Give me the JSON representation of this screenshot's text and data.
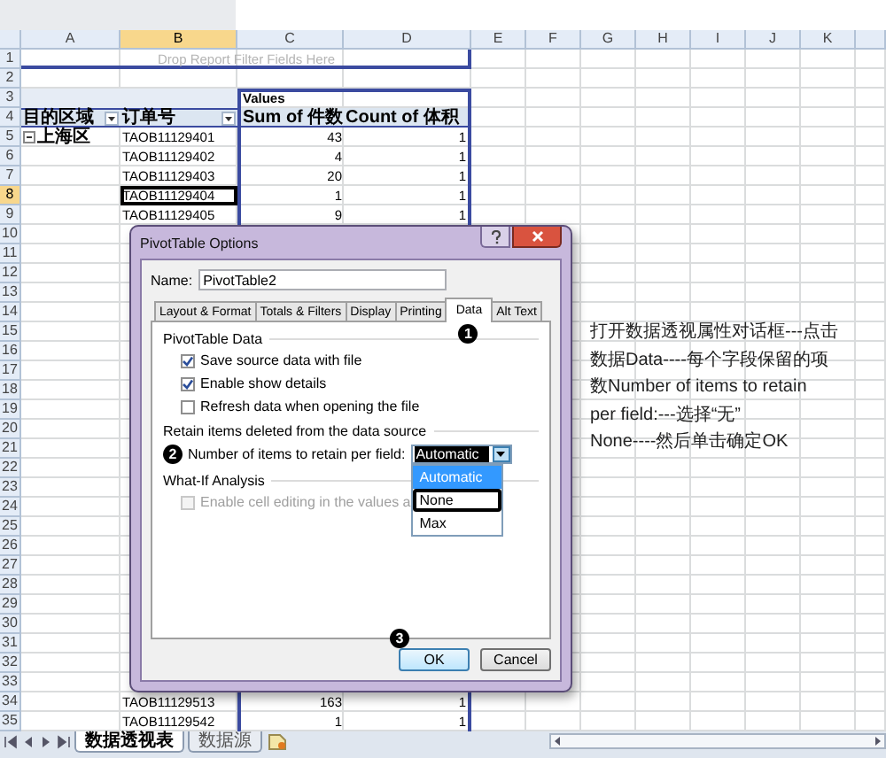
{
  "sheet": {
    "columns": [
      {
        "label": "A",
        "selected": false
      },
      {
        "label": "B",
        "selected": true
      },
      {
        "label": "C",
        "selected": false
      },
      {
        "label": "D",
        "selected": false
      },
      {
        "label": "E",
        "selected": false
      },
      {
        "label": "F",
        "selected": false
      },
      {
        "label": "G",
        "selected": false
      },
      {
        "label": "H",
        "selected": false
      },
      {
        "label": "I",
        "selected": false
      },
      {
        "label": "J",
        "selected": false
      },
      {
        "label": "K",
        "selected": false
      }
    ],
    "rows": [
      {
        "number": "1",
        "selected": false,
        "kind": "filter_area",
        "cells": {
          "col_a": "Drop Report Filter Fields Here"
        }
      },
      {
        "number": "2",
        "selected": false,
        "kind": "blank"
      },
      {
        "number": "3",
        "selected": false,
        "kind": "values_label",
        "cells": {
          "col_c": "Values"
        }
      },
      {
        "number": "4",
        "selected": false,
        "kind": "field_header",
        "cells": {
          "col_a": "目的区域",
          "col_b": "订单号",
          "col_c": "Sum of 件数",
          "col_d": "Count of 体积"
        }
      },
      {
        "number": "5",
        "selected": false,
        "kind": "group",
        "cells": {
          "col_a": "上海区",
          "col_b": "TAOB11129401",
          "col_c": "43",
          "col_d": "1"
        }
      },
      {
        "number": "6",
        "selected": false,
        "kind": "data",
        "cells": {
          "col_b": "TAOB11129402",
          "col_c": "4",
          "col_d": "1"
        }
      },
      {
        "number": "7",
        "selected": false,
        "kind": "data",
        "cells": {
          "col_b": "TAOB11129403",
          "col_c": "20",
          "col_d": "1"
        }
      },
      {
        "number": "8",
        "selected": true,
        "kind": "data",
        "cells": {
          "col_b": "TAOB11129404",
          "col_c": "1",
          "col_d": "1"
        }
      },
      {
        "number": "9",
        "selected": false,
        "kind": "data",
        "cells": {
          "col_b": "TAOB11129405",
          "col_c": "9",
          "col_d": "1"
        }
      },
      {
        "number": "10",
        "selected": false,
        "kind": "data"
      },
      {
        "number": "11",
        "selected": false,
        "kind": "data"
      },
      {
        "number": "12",
        "selected": false,
        "kind": "data"
      },
      {
        "number": "13",
        "selected": false,
        "kind": "data"
      },
      {
        "number": "14",
        "selected": false,
        "kind": "data"
      },
      {
        "number": "15",
        "selected": false,
        "kind": "data"
      },
      {
        "number": "16",
        "selected": false,
        "kind": "data"
      },
      {
        "number": "17",
        "selected": false,
        "kind": "data"
      },
      {
        "number": "18",
        "selected": false,
        "kind": "data"
      },
      {
        "number": "19",
        "selected": false,
        "kind": "data"
      },
      {
        "number": "20",
        "selected": false,
        "kind": "data"
      },
      {
        "number": "21",
        "selected": false,
        "kind": "data"
      },
      {
        "number": "22",
        "selected": false,
        "kind": "data"
      },
      {
        "number": "23",
        "selected": false,
        "kind": "data"
      },
      {
        "number": "24",
        "selected": false,
        "kind": "data"
      },
      {
        "number": "25",
        "selected": false,
        "kind": "data"
      },
      {
        "number": "26",
        "selected": false,
        "kind": "data"
      },
      {
        "number": "27",
        "selected": false,
        "kind": "data"
      },
      {
        "number": "28",
        "selected": false,
        "kind": "data"
      },
      {
        "number": "29",
        "selected": false,
        "kind": "data"
      },
      {
        "number": "30",
        "selected": false,
        "kind": "data"
      },
      {
        "number": "31",
        "selected": false,
        "kind": "data"
      },
      {
        "number": "32",
        "selected": false,
        "kind": "data"
      },
      {
        "number": "33",
        "selected": false,
        "kind": "data"
      },
      {
        "number": "34",
        "selected": false,
        "kind": "data",
        "cells": {
          "col_b": "TAOB11129513",
          "col_c": "163",
          "col_d": "1"
        }
      },
      {
        "number": "35",
        "selected": false,
        "kind": "data",
        "cells": {
          "col_b": "TAOB11129542",
          "col_c": "1",
          "col_d": "1"
        }
      }
    ]
  },
  "note": {
    "lines": [
      "打开数据透视属性对话框---点击",
      "数据Data----每个字段保留的项",
      "数Number of items to retain",
      "per field:---选择“无”",
      "None----然后单击确定OK"
    ]
  },
  "dialog": {
    "title": "PivotTable Options",
    "name_label": "Name:",
    "name_value": "PivotTable2",
    "tabs": [
      {
        "label": "Layout & Format",
        "selected": false
      },
      {
        "label": "Totals & Filters",
        "selected": false
      },
      {
        "label": "Display",
        "selected": false
      },
      {
        "label": "Printing",
        "selected": false
      },
      {
        "label": "Data",
        "selected": true,
        "step": "1"
      },
      {
        "label": "Alt Text",
        "selected": false
      }
    ],
    "sections": [
      {
        "title": "PivotTable Data",
        "items": [
          {
            "kind": "checkbox",
            "label": "Save source data with file",
            "checked": true,
            "disabled": false
          },
          {
            "kind": "checkbox",
            "label": "Enable show details",
            "checked": true,
            "disabled": false
          },
          {
            "kind": "checkbox",
            "label": "Refresh data when opening the file",
            "checked": false,
            "disabled": false
          }
        ]
      },
      {
        "title": "Retain items deleted from the data source",
        "items": [
          {
            "kind": "dropdown",
            "step": "2",
            "label": "Number of items to retain per field:",
            "value": "Automatic",
            "expanded": true,
            "options": [
              {
                "label": "Automatic",
                "selected": true,
                "outlined": false
              },
              {
                "label": "None",
                "selected": false,
                "outlined": true
              },
              {
                "label": "Max",
                "selected": false,
                "outlined": false
              }
            ]
          }
        ]
      },
      {
        "title": "What-If Analysis",
        "items": [
          {
            "kind": "checkbox",
            "label": "Enable cell editing in the values a",
            "checked": false,
            "disabled": true
          }
        ]
      }
    ],
    "buttons": [
      {
        "label": "OK",
        "default": true,
        "step": "3"
      },
      {
        "label": "Cancel",
        "default": false
      }
    ]
  },
  "sheet_tabs": [
    {
      "label": "数据透视表",
      "selected": true
    },
    {
      "label": "数据源",
      "selected": false
    }
  ]
}
